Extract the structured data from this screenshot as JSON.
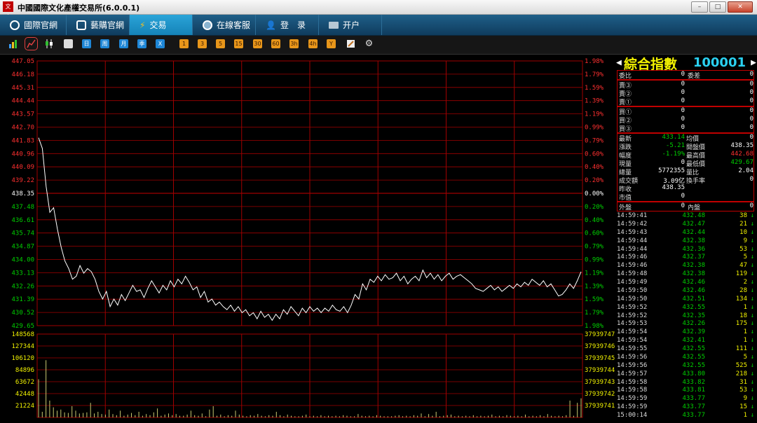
{
  "window": {
    "title": "中國國際文化產權交易所(6.0.0.1)",
    "logo_text": "文產"
  },
  "nav": [
    {
      "label": "國際官網",
      "active": false
    },
    {
      "label": "藝購官網",
      "active": false
    },
    {
      "label": "交易",
      "active": true
    },
    {
      "label": "在線客服",
      "active": false
    },
    {
      "label": "登　录",
      "active": false
    },
    {
      "label": "开户",
      "active": false
    }
  ],
  "toolbar": {
    "period_buttons": [
      "日",
      "周",
      "月",
      "季",
      "X"
    ],
    "minute_buttons": [
      "1",
      "3",
      "5",
      "15",
      "30",
      "60",
      "3h",
      "4h",
      "Y"
    ]
  },
  "instrument": {
    "name": "綜合指數",
    "code": "100001"
  },
  "colors": {
    "up": "#ff3030",
    "down": "#00d000",
    "flat": "#ffffff",
    "grid": "#a00000",
    "bg": "#000000",
    "label_yellow": "#f2f200",
    "code_cyan": "#2ad0f0"
  },
  "quote_rows": {
    "wei": [
      {
        "l": "委比",
        "v": "0",
        "l2": "委差",
        "v2": "0"
      }
    ],
    "sell": [
      {
        "l": "賣③",
        "v": "0",
        "v2": "0"
      },
      {
        "l": "賣②",
        "v": "0",
        "v2": "0"
      },
      {
        "l": "賣①",
        "v": "0",
        "v2": "0"
      }
    ],
    "buy": [
      {
        "l": "買①",
        "v": "0",
        "v2": "0"
      },
      {
        "l": "買②",
        "v": "0",
        "v2": "0"
      },
      {
        "l": "買③",
        "v": "0",
        "v2": "0"
      }
    ],
    "stats": [
      {
        "l": "最新",
        "v": "433.14",
        "vc": "down",
        "l2": "均價",
        "v2": "0",
        "v2c": "flat"
      },
      {
        "l": "漲跌",
        "v": "-5.21",
        "vc": "down",
        "l2": "開盤價",
        "v2": "438.35",
        "v2c": "flat"
      },
      {
        "l": "幅度",
        "v": "-1.19%",
        "vc": "down",
        "l2": "最高價",
        "v2": "442.68",
        "v2c": "up"
      },
      {
        "l": "現量",
        "v": "0",
        "vc": "flat",
        "l2": "最低價",
        "v2": "429.67",
        "v2c": "down"
      },
      {
        "l": "總量",
        "v": "5772355",
        "vc": "flat",
        "l2": "量比",
        "v2": "2.04",
        "v2c": "flat"
      },
      {
        "l": "成交額",
        "v": "3.09亿",
        "vc": "flat",
        "l2": "換手率",
        "v2": "0",
        "v2c": "flat"
      },
      {
        "l": "昨收",
        "v": "438.35",
        "vc": "flat",
        "l2": "",
        "v2": "",
        "v2c": "flat"
      },
      {
        "l": "市值",
        "v": "0",
        "vc": "flat",
        "l2": "",
        "v2": "",
        "v2c": "flat"
      }
    ],
    "outin": [
      {
        "l": "外盤",
        "v": "0",
        "l2": "內盤",
        "v2": "0"
      }
    ]
  },
  "ticks": [
    {
      "t": "14:59:41",
      "p": "432.48",
      "q": "38"
    },
    {
      "t": "14:59:42",
      "p": "432.47",
      "q": "21"
    },
    {
      "t": "14:59:43",
      "p": "432.44",
      "q": "10"
    },
    {
      "t": "14:59:44",
      "p": "432.38",
      "q": "9"
    },
    {
      "t": "14:59:44",
      "p": "432.36",
      "q": "53"
    },
    {
      "t": "14:59:46",
      "p": "432.37",
      "q": "5"
    },
    {
      "t": "14:59:46",
      "p": "432.38",
      "q": "47"
    },
    {
      "t": "14:59:48",
      "p": "432.38",
      "q": "119"
    },
    {
      "t": "14:59:49",
      "p": "432.46",
      "q": "2"
    },
    {
      "t": "14:59:50",
      "p": "432.46",
      "q": "28"
    },
    {
      "t": "14:59:50",
      "p": "432.51",
      "q": "134"
    },
    {
      "t": "14:59:52",
      "p": "432.55",
      "q": "1"
    },
    {
      "t": "14:59:52",
      "p": "432.35",
      "q": "18"
    },
    {
      "t": "14:59:53",
      "p": "432.26",
      "q": "175"
    },
    {
      "t": "14:59:54",
      "p": "432.39",
      "q": "1"
    },
    {
      "t": "14:59:54",
      "p": "432.41",
      "q": "1"
    },
    {
      "t": "14:59:55",
      "p": "432.55",
      "q": "111"
    },
    {
      "t": "14:59:56",
      "p": "432.55",
      "q": "5"
    },
    {
      "t": "14:59:56",
      "p": "432.55",
      "q": "525"
    },
    {
      "t": "14:59:57",
      "p": "433.80",
      "q": "218"
    },
    {
      "t": "14:59:58",
      "p": "433.82",
      "q": "31"
    },
    {
      "t": "14:59:58",
      "p": "433.81",
      "q": "53"
    },
    {
      "t": "14:59:59",
      "p": "433.77",
      "q": "9"
    },
    {
      "t": "14:59:59",
      "p": "433.77",
      "q": "15"
    },
    {
      "t": "15:00:14",
      "p": "433.77",
      "q": "1"
    }
  ],
  "chart_data": {
    "type": "line",
    "prev_close": 438.35,
    "price_ticks": [
      "447.05",
      "446.18",
      "445.31",
      "444.44",
      "443.57",
      "442.70",
      "441.83",
      "440.96",
      "440.09",
      "439.22",
      "438.35",
      "437.48",
      "436.61",
      "435.74",
      "434.87",
      "434.00",
      "433.13",
      "432.26",
      "431.39",
      "430.52",
      "429.65"
    ],
    "pct_ticks": [
      "1.98%",
      "1.79%",
      "1.59%",
      "1.39%",
      "1.19%",
      "0.99%",
      "0.79%",
      "0.60%",
      "0.40%",
      "0.20%",
      "0.00%",
      "0.20%",
      "0.40%",
      "0.60%",
      "0.79%",
      "0.99%",
      "1.19%",
      "1.39%",
      "1.59%",
      "1.79%",
      "1.98%"
    ],
    "price_range": [
      429.65,
      447.05
    ],
    "volume_ticks": [
      "148568",
      "127344",
      "106120",
      "84896",
      "63672",
      "42448",
      "21224"
    ],
    "volume_right_ticks": [
      "37939747",
      "37939746",
      "37939745",
      "37939744",
      "37939743",
      "37939742",
      "37939741"
    ],
    "volume_max": 148568,
    "price_series": [
      442.0,
      441.3,
      438.8,
      437.1,
      437.4,
      436.0,
      434.8,
      433.9,
      433.4,
      432.7,
      432.9,
      433.6,
      433.1,
      433.4,
      433.2,
      432.7,
      431.9,
      431.4,
      431.9,
      430.9,
      431.4,
      431.0,
      431.7,
      431.3,
      431.8,
      432.3,
      431.9,
      432.0,
      431.5,
      432.1,
      432.6,
      432.2,
      431.8,
      432.3,
      432.0,
      432.6,
      432.2,
      432.7,
      432.4,
      432.9,
      432.5,
      432.0,
      432.2,
      431.5,
      431.9,
      431.2,
      431.4,
      431.0,
      431.2,
      430.9,
      430.7,
      431.0,
      430.6,
      430.9,
      430.5,
      430.7,
      430.3,
      430.5,
      430.1,
      430.6,
      430.2,
      430.4,
      430.0,
      430.4,
      430.1,
      430.7,
      430.4,
      430.9,
      430.6,
      430.3,
      430.8,
      430.5,
      430.9,
      430.6,
      430.8,
      430.5,
      430.8,
      430.6,
      431.0,
      430.7,
      430.6,
      430.9,
      430.5,
      431.0,
      431.7,
      431.4,
      432.4,
      432.0,
      432.7,
      432.5,
      432.9,
      432.6,
      433.0,
      432.7,
      432.8,
      433.1,
      432.6,
      432.9,
      432.4,
      432.7,
      432.9,
      432.6,
      433.3,
      432.8,
      433.1,
      432.7,
      433.0,
      432.6,
      432.9,
      433.1,
      432.7,
      432.9,
      433.0,
      432.8,
      432.6,
      432.4,
      432.1,
      432.0,
      431.9,
      432.1,
      432.3,
      432.0,
      432.2,
      431.9,
      432.1,
      432.3,
      432.1,
      432.4,
      432.2,
      432.5,
      432.3,
      432.7,
      432.5,
      432.3,
      432.6,
      432.2,
      432.4,
      432.0,
      431.6,
      431.7,
      432.0,
      432.4,
      432.1,
      432.6,
      433.2
    ],
    "volume_series": [
      68000,
      10000,
      102000,
      30000,
      18000,
      12000,
      14000,
      9000,
      8000,
      20000,
      12000,
      7000,
      8000,
      9000,
      26000,
      7000,
      10000,
      6000,
      5000,
      14000,
      6000,
      4000,
      12000,
      3000,
      5000,
      8000,
      4000,
      10000,
      3000,
      6000,
      4000,
      9000,
      16000,
      3000,
      5000,
      7000,
      4000,
      6000,
      3000,
      3000,
      5000,
      12000,
      4000,
      3000,
      7000,
      2000,
      14000,
      20000,
      3000,
      5000,
      2000,
      4000,
      3000,
      12000,
      5000,
      3000,
      2000,
      4000,
      3000,
      6000,
      3000,
      2000,
      4000,
      3000,
      10000,
      4000,
      2000,
      5000,
      3000,
      2000,
      2000,
      3000,
      5000,
      2000,
      3000,
      2000,
      4000,
      2000,
      3000,
      2000,
      3000,
      2000,
      4000,
      3000,
      2000,
      2000,
      6000,
      3000,
      2000,
      3000,
      2000,
      4000,
      3000,
      2000,
      2000,
      2000,
      3000,
      4000,
      2000,
      3000,
      2000,
      4000,
      3000,
      7000,
      2000,
      6000,
      3000,
      10000,
      2000,
      3000,
      4000,
      5000,
      2000,
      3000,
      2000,
      3000,
      2000,
      4000,
      2000,
      3000,
      2000,
      3000,
      5000,
      2000,
      3000,
      2000,
      4000,
      3000,
      2000,
      3000,
      2000,
      5000,
      2000,
      3000,
      2000,
      4000,
      2000,
      6000,
      3000,
      2000,
      3000,
      2000,
      4000,
      30000,
      3000,
      26000,
      34000
    ]
  }
}
